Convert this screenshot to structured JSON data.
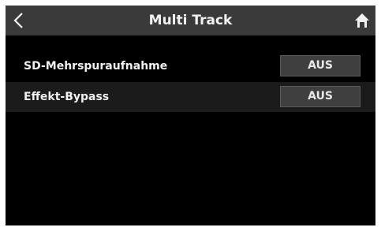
{
  "header": {
    "title": "Multi Track",
    "back_icon": "back-chevron-icon",
    "home_icon": "home-icon"
  },
  "settings": [
    {
      "label": "SD-Mehrspuraufnahme",
      "value": "AUS"
    },
    {
      "label": "Effekt-Bypass",
      "value": "AUS"
    }
  ],
  "colors": {
    "header_bg": "#3a3a3a",
    "screen_bg": "#000000",
    "button_bg": "#3f3f3f",
    "text": "#f0f0f0"
  }
}
